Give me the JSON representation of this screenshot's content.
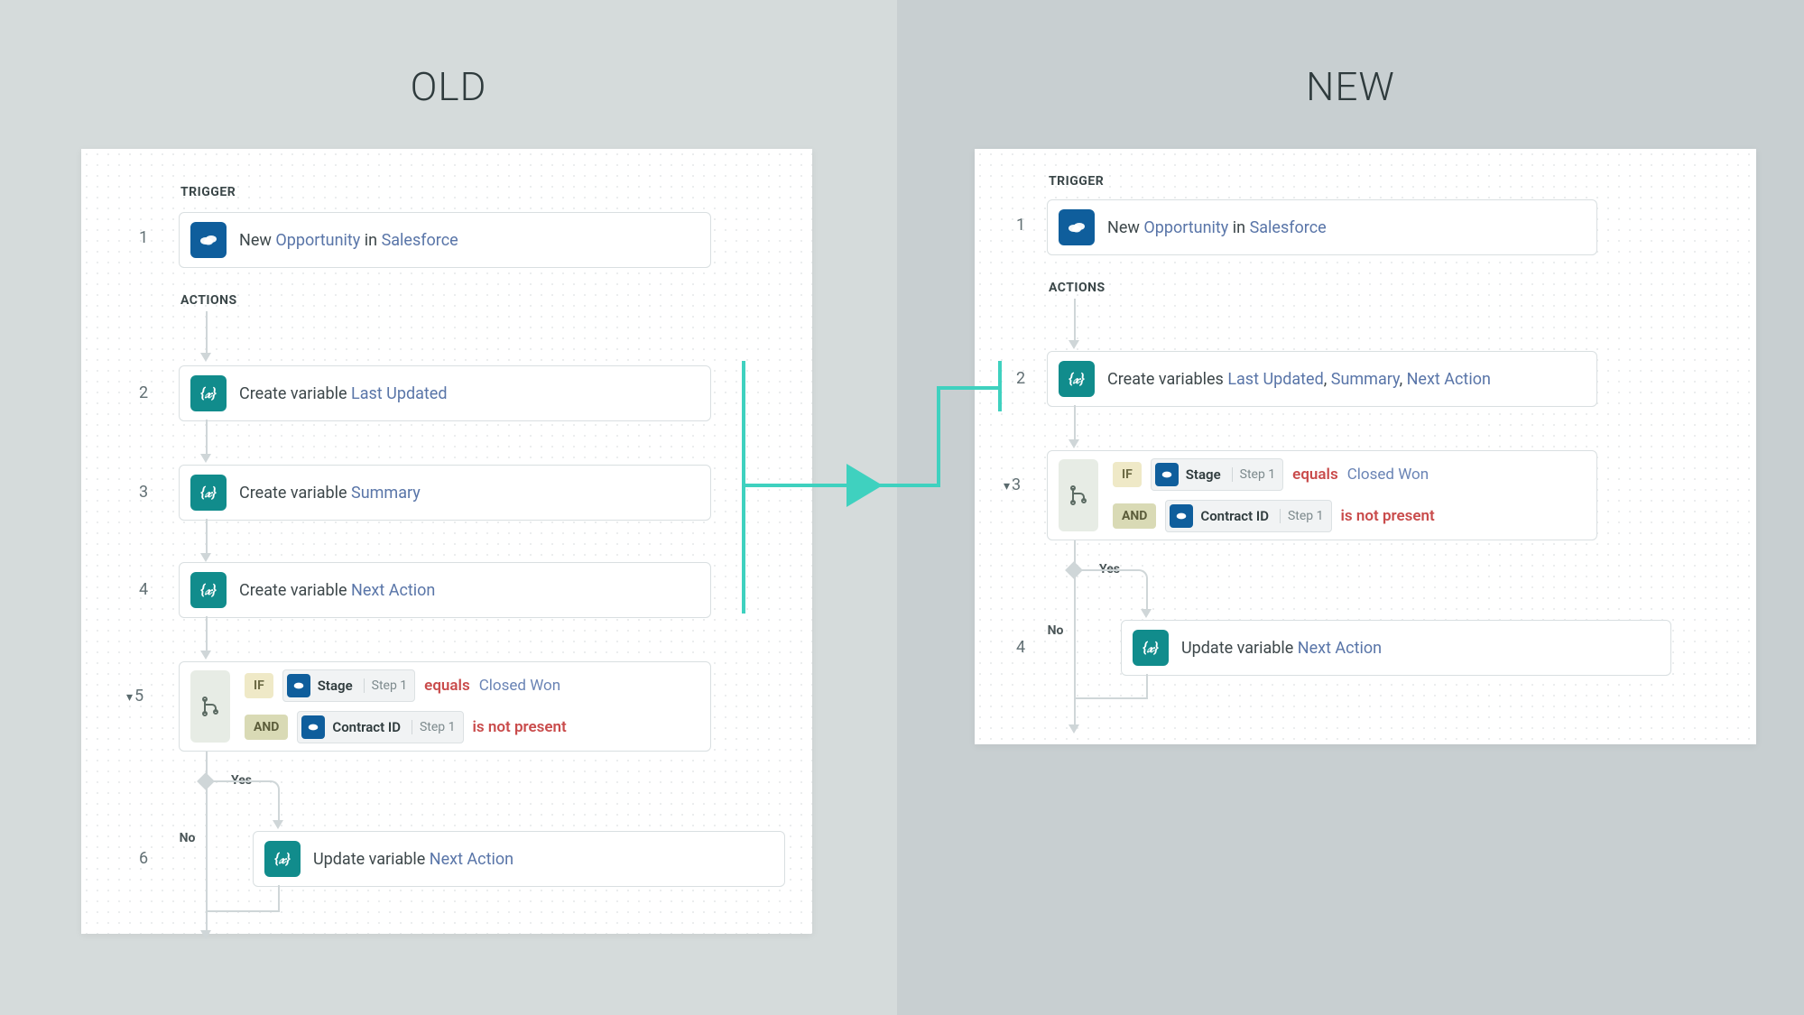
{
  "titles": {
    "old": "OLD",
    "new": "NEW"
  },
  "labels": {
    "trigger": "TRIGGER",
    "actions": "ACTIONS",
    "yes": "Yes",
    "no": "No",
    "if": "IF",
    "and": "AND",
    "step1": "Step 1"
  },
  "trigger": {
    "prefix": "New ",
    "object": "Opportunity",
    "mid": " in ",
    "app": "Salesforce"
  },
  "old": {
    "step_nums": [
      "1",
      "2",
      "3",
      "4",
      "5",
      "6"
    ],
    "var_prefix": "Create variable ",
    "var1": "Last Updated",
    "var2": "Summary",
    "var3": "Next Action",
    "cond": {
      "field1": "Stage",
      "pred1": "equals",
      "val1": "Closed Won",
      "field2": "Contract ID",
      "pred2": "is not present"
    },
    "update_prefix": "Update variable ",
    "update_var": "Next Action"
  },
  "new": {
    "step_nums": [
      "1",
      "2",
      "3",
      "4"
    ],
    "vars_prefix": "Create variables ",
    "vars": [
      "Last Updated",
      "Summary",
      "Next Action"
    ],
    "cond": {
      "field1": "Stage",
      "pred1": "equals",
      "val1": "Closed Won",
      "field2": "Contract ID",
      "pred2": "is not present"
    },
    "update_prefix": "Update variable ",
    "update_var": "Next Action"
  }
}
